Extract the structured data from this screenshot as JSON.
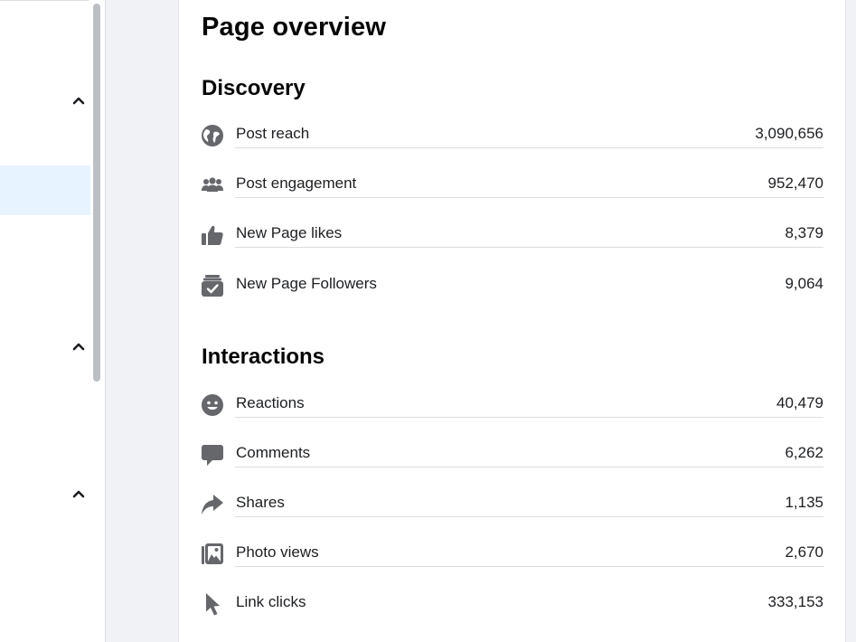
{
  "page": {
    "title": "Page overview"
  },
  "discovery": {
    "title": "Discovery",
    "metrics": [
      {
        "icon": "globe-icon",
        "label": "Post reach",
        "value": "3,090,656"
      },
      {
        "icon": "people-icon",
        "label": "Post engagement",
        "value": "952,470"
      },
      {
        "icon": "thumbs-up-icon",
        "label": "New Page likes",
        "value": "8,379"
      },
      {
        "icon": "follow-inbox-icon",
        "label": "New Page Followers",
        "value": "9,064"
      }
    ]
  },
  "interactions": {
    "title": "Interactions",
    "metrics": [
      {
        "icon": "smiley-icon",
        "label": "Reactions",
        "value": "40,479"
      },
      {
        "icon": "comment-bubble-icon",
        "label": "Comments",
        "value": "6,262"
      },
      {
        "icon": "share-arrow-icon",
        "label": "Shares",
        "value": "1,135"
      },
      {
        "icon": "photo-icon",
        "label": "Photo views",
        "value": "2,670"
      },
      {
        "icon": "cursor-icon",
        "label": "Link clicks",
        "value": "333,153"
      }
    ]
  },
  "colors": {
    "icon": "#65676b",
    "divider": "#dadde1",
    "highlight": "#e7f3ff",
    "background": "#f0f2f5"
  }
}
